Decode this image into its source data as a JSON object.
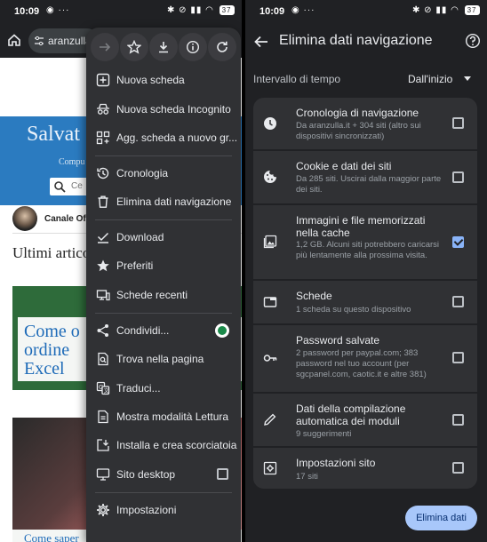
{
  "left_status": {
    "time": "10:09",
    "battery": "37"
  },
  "right_status": {
    "time": "10:09",
    "battery": "37"
  },
  "browser": {
    "url": "aranzulla"
  },
  "website": {
    "hero_title": "Salvat",
    "hero_subtitle": "Compu",
    "search_placeholder": "Ce",
    "channel": "Canale Offe",
    "section_title": "Ultimi artico",
    "card1_text": "Come o\nordine\nExcel",
    "card2_text": "Come saper"
  },
  "menu": {
    "toolbar_icons": [
      "forward-icon",
      "star-icon",
      "download-icon",
      "info-icon",
      "refresh-icon"
    ],
    "items": [
      {
        "label": "Nuova scheda",
        "icon": "plus-square-icon"
      },
      {
        "label": "Nuova scheda Incognito",
        "icon": "incognito-icon"
      },
      {
        "label": "Agg. scheda a nuovo gr...",
        "icon": "tab-group-icon"
      },
      {
        "label": "Cronologia",
        "icon": "history-icon"
      },
      {
        "label": "Elimina dati navigazione",
        "icon": "trash-icon"
      },
      {
        "label": "Download",
        "icon": "download-check-icon"
      },
      {
        "label": "Preferiti",
        "icon": "star-filled-icon"
      },
      {
        "label": "Schede recenti",
        "icon": "recent-tabs-icon"
      },
      {
        "label": "Condividi...",
        "icon": "share-icon"
      },
      {
        "label": "Trova nella pagina",
        "icon": "find-in-page-icon"
      },
      {
        "label": "Traduci...",
        "icon": "translate-icon"
      },
      {
        "label": "Mostra modalità Lettura",
        "icon": "reader-mode-icon"
      },
      {
        "label": "Installa e crea scorciatoia",
        "icon": "install-icon"
      },
      {
        "label": "Sito desktop",
        "icon": "desktop-icon",
        "checked": false
      },
      {
        "label": "Impostazioni",
        "icon": "settings-icon"
      }
    ]
  },
  "clear_data": {
    "title": "Elimina dati navigazione",
    "time_range_label": "Intervallo di tempo",
    "time_range_value": "Dall'inizio",
    "options": [
      {
        "title": "Cronologia di navigazione",
        "desc": "Da aranzulla.it + 304 siti (altro sui dispositivi sincronizzati)",
        "checked": false,
        "icon": "clock-icon"
      },
      {
        "title": "Cookie e dati dei siti",
        "desc": "Da 285 siti. Uscirai dalla maggior parte dei siti.",
        "checked": false,
        "icon": "cookie-icon"
      },
      {
        "title": "Immagini e file memorizzati nella cache",
        "desc": "1,2 GB. Alcuni siti potrebbero caricarsi più lentamente alla prossima visita.",
        "checked": true,
        "icon": "image-icon"
      },
      {
        "title": "Schede",
        "desc": "1 scheda su questo dispositivo",
        "checked": false,
        "icon": "tab-icon"
      },
      {
        "title": "Password salvate",
        "desc": "2 password per paypal.com; 383 password nel tuo account (per sgcpanel.com, caotic.it e altre 381)",
        "checked": false,
        "icon": "key-icon"
      },
      {
        "title": "Dati della compilazione automatica dei moduli",
        "desc": "9 suggerimenti",
        "checked": false,
        "icon": "pencil-icon"
      },
      {
        "title": "Impostazioni sito",
        "desc": "17 siti",
        "checked": false,
        "icon": "site-settings-icon"
      }
    ],
    "clear_button": "Elimina dati"
  },
  "colors": {
    "accent": "#a8c7fa",
    "checkbox_on": "#8ab4f8",
    "panel": "#303134",
    "background": "#202124"
  }
}
